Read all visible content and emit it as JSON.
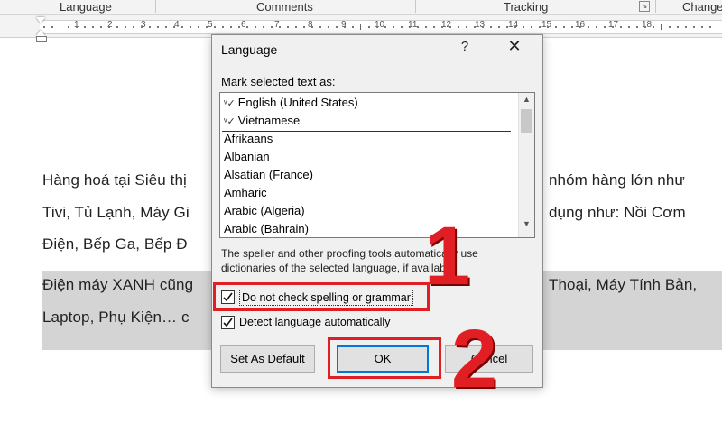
{
  "ribbon": {
    "groups": [
      "Language",
      "Comments",
      "Tracking",
      "Change"
    ]
  },
  "ruler": {
    "numbers": [
      "1",
      "2",
      "3",
      "4",
      "5",
      "6",
      "7",
      "8",
      "9",
      "10",
      "11",
      "12",
      "13",
      "14",
      "15",
      "16",
      "17",
      "18"
    ]
  },
  "document": {
    "lines": [
      "Hàng hoá tại Siêu thị",
      "Tivi, Tủ Lạnh, Máy Gi",
      "Điện, Bếp Ga, Bếp Đ",
      "Điện máy XANH cũng",
      "Laptop, Phụ Kiện… c",
      "nhóm hàng lớn như",
      "dụng như: Nồi Cơm",
      "Thoại, Máy Tính Bản,"
    ]
  },
  "dialog": {
    "title": "Language",
    "help": "?",
    "close": "✕",
    "mark_label": "Mark selected text as:",
    "languages_pinned": [
      "English (United States)",
      "Vietnamese"
    ],
    "languages": [
      "Afrikaans",
      "Albanian",
      "Alsatian (France)",
      "Amharic",
      "Arabic (Algeria)",
      "Arabic (Bahrain)"
    ],
    "info_line1": "The speller and other proofing tools automatically use",
    "info_line2": "dictionaries of the selected language, if available.",
    "checkbox_no_spell": {
      "label": "Do not check spelling or grammar",
      "checked": true
    },
    "checkbox_detect": {
      "label": "Detect language automatically",
      "checked": true
    },
    "btn_default": "Set As Default",
    "btn_ok": "OK",
    "btn_cancel": "Cancel"
  },
  "annotations": {
    "step1": "1",
    "step2": "2",
    "color": "#e01e24"
  }
}
